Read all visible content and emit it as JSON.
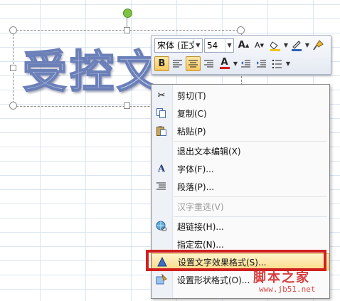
{
  "wordart": {
    "text": "受控文"
  },
  "mini_toolbar": {
    "font_name": "宋体 (正文",
    "font_size": "54",
    "grow_font_icon": "A",
    "shrink_font_icon": "A",
    "bold_label": "B",
    "font_color_label": "A"
  },
  "context_menu": {
    "items": [
      {
        "label": "剪切(T)",
        "icon": "scissors-icon"
      },
      {
        "label": "复制(C)",
        "icon": "copy-icon"
      },
      {
        "label": "粘贴(P)",
        "icon": "paste-icon"
      },
      {
        "label": "退出文本编辑(X)",
        "icon": ""
      },
      {
        "label": "字体(F)...",
        "icon": "font-icon"
      },
      {
        "label": "段落(P)...",
        "icon": "paragraph-icon"
      },
      {
        "label": "汉字重选(V)",
        "icon": "",
        "disabled": true
      },
      {
        "label": "超链接(H)...",
        "icon": "hyperlink-icon"
      },
      {
        "label": "指定宏(N)...",
        "icon": ""
      },
      {
        "label": "设置文字效果格式(S)...",
        "icon": "text-effect-icon",
        "highlighted": true
      },
      {
        "label": "设置形状格式(O)...",
        "icon": "shape-format-icon"
      }
    ]
  },
  "watermark": {
    "line1": "脚本之家",
    "line2": "www.jb51.net"
  },
  "colors": {
    "highlight": "#fbdc8a",
    "callout_red": "#d11f1f",
    "accent_green": "#7ec342"
  }
}
